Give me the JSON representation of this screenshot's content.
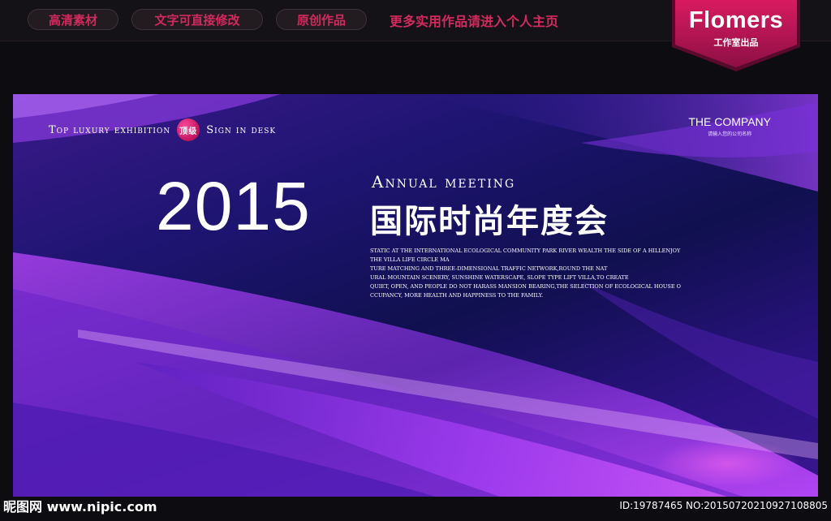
{
  "top_bar": {
    "pills": [
      "高清素材",
      "文字可直接修改",
      "原创作品"
    ],
    "promo": "更多实用作品请进入个人主页"
  },
  "brand": {
    "name": "Flomers",
    "subtitle": "工作室出品"
  },
  "poster": {
    "tagline_left": "Top luxury exhibition",
    "badge": "顶级",
    "tagline_right": "Sign in desk",
    "company": "THE COMPANY",
    "company_sub": "请输入您的公司名称",
    "year": "2015",
    "annual": "Annual meeting",
    "title_cn": "国际时尚年度会",
    "blurb": [
      "STATIC AT THE INTERNATIONAL ECOLOGICAL COMMUNITY PARK RIVER WEALTH THE SIDE OF A HILLENJOY",
      "THE VILLA LIFE CIRCLE MA",
      "TURE MATCHING AND THREE-DIMENSIONAL TRAFFIC NETWORK,ROUND THE NAT",
      "URAL MOUNTAIN SCENERY, SUNSHINE WATERSCAPE, SLOPE TYPE LIFT VILLA,TO CREATE",
      "QUIET, OPEN, AND PEOPLE DO NOT HARASS MANSION BEARING,THE SELECTION OF ECOLOGICAL HOUSE O",
      "CCUPANCY, MORE HEALTH AND HAPPINESS TO THE FAMILY."
    ]
  },
  "footer": {
    "site": "昵图网 www.nipic.com",
    "id_text": "ID:19787465 NO:20150720210927108805"
  },
  "colors": {
    "accent": "#d22a5e",
    "brand_bg": "#c2185b"
  }
}
